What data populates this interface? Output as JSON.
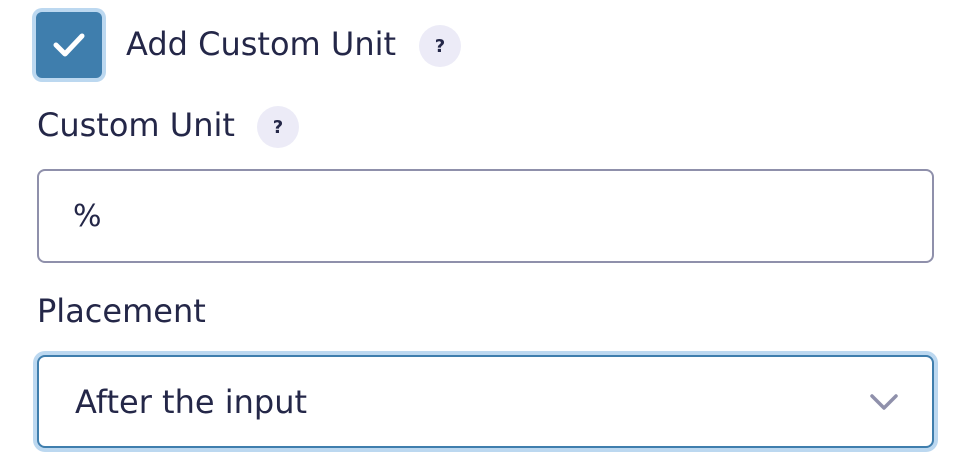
{
  "custom_unit_toggle": {
    "checked": true,
    "label": "Add Custom Unit",
    "help_icon": "?"
  },
  "custom_unit": {
    "label": "Custom Unit",
    "help_icon": "?",
    "value": "%"
  },
  "placement": {
    "label": "Placement",
    "selected": "After the input",
    "icon": "chevron-down-icon"
  },
  "colors": {
    "checkbox_fill": "#3f7ead",
    "focus_ring": "#bcd8f0",
    "help_badge_bg": "#ecebf7",
    "text": "#242748",
    "input_border": "#8f90ab"
  }
}
